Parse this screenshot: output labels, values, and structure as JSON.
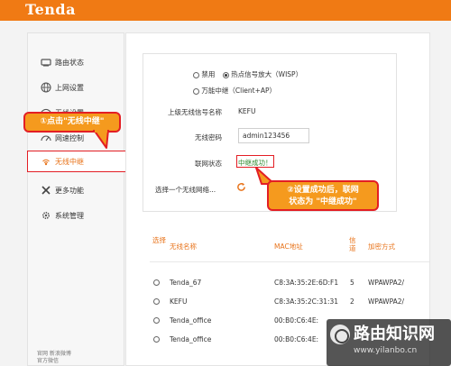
{
  "brand": "Tenda",
  "sidebar": {
    "items": [
      {
        "label": "路由状态",
        "icon": "status-icon"
      },
      {
        "label": "上网设置",
        "icon": "globe-icon"
      },
      {
        "label": "无线设置",
        "icon": "wifi-icon"
      },
      {
        "label": "网速控制",
        "icon": "speed-icon"
      },
      {
        "label": "无线中继",
        "icon": "repeater-icon"
      },
      {
        "label": "更多功能",
        "icon": "tools-icon"
      },
      {
        "label": "系统管理",
        "icon": "gear-icon"
      }
    ],
    "footer_line1": "官网  新浪微博",
    "footer_line2": "官方微信"
  },
  "mode": {
    "opt_disable": "禁用",
    "opt_wisp": "热点信号放大（WISP）",
    "opt_client_ap": "万能中继（Client+AP）",
    "selected": "wisp"
  },
  "form": {
    "ssid_label": "上级无线信号名称",
    "ssid_value": "KEFU",
    "password_label": "无线密码",
    "password_value": "admin123456",
    "status_label": "联网状态",
    "status_value": "中继成功！",
    "select_label": "选择一个无线网络..."
  },
  "table": {
    "headers": {
      "select": "选择",
      "name": "无线名称",
      "mac": "MAC地址",
      "channel": "信道",
      "encrypt": "加密方式"
    },
    "rows": [
      {
        "name": "Tenda_67",
        "mac": "C8:3A:35:2E:6D:F1",
        "channel": "5",
        "encrypt": "WPAWPA2/"
      },
      {
        "name": "KEFU",
        "mac": "C8:3A:35:2C:31:31",
        "channel": "2",
        "encrypt": "WPAWPA2/"
      },
      {
        "name": "Tenda_office",
        "mac": "00:B0:C6:4E:",
        "channel": "",
        "encrypt": ""
      },
      {
        "name": "Tenda_office",
        "mac": "00:B0:C6:4E:",
        "channel": "",
        "encrypt": ""
      }
    ]
  },
  "callouts": {
    "step1": "①点击\"无线中继\"",
    "step2_line1": "②设置成功后，联网",
    "step2_line2": "状态为 \"中继成功\""
  },
  "watermark": {
    "title": "路由知识网",
    "url": "www.yilanbo.cn"
  },
  "colors": {
    "brand": "#f07a14",
    "accent": "#e8731a",
    "highlight": "#e31e24",
    "success": "#2e8b2e"
  }
}
